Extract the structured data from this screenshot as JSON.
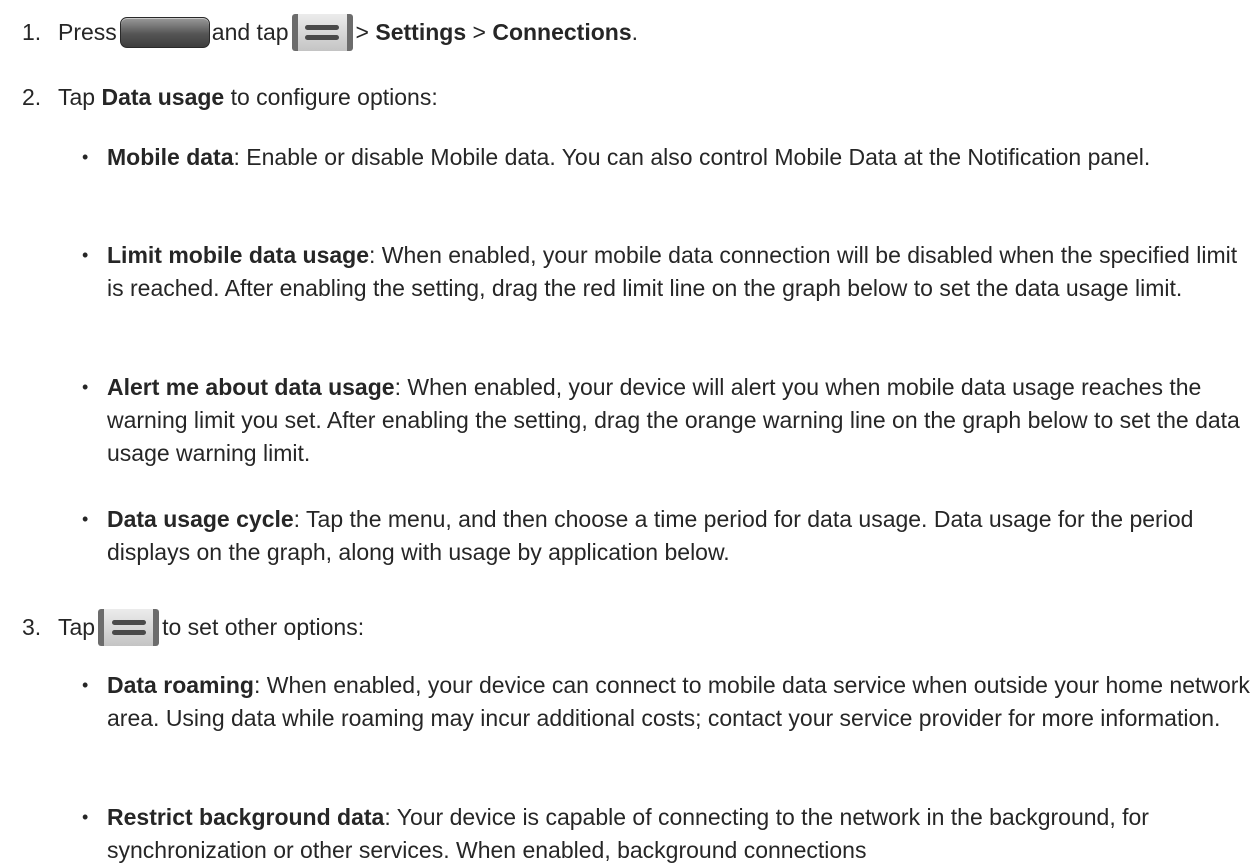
{
  "step1": {
    "number": "1.",
    "press": "Press",
    "and_tap": "and tap",
    "sep1": ">",
    "settings": "Settings",
    "sep2": ">",
    "connections": "Connections",
    "end": ".",
    "home_key_icon": "home-key-icon",
    "menu_key_icon": "menu-key-icon"
  },
  "step2": {
    "number": "2.",
    "tap": "Tap",
    "data_usage": "Data usage",
    "rest": "to configure options:"
  },
  "bullets_a": [
    {
      "term": "Mobile data",
      "desc": ": Enable or disable Mobile data. You can also control Mobile Data at the Notification panel."
    },
    {
      "term": "Limit mobile data usage",
      "desc": ": When enabled, your mobile data connection will be disabled when the specified limit is reached. After enabling the setting, drag the red limit line on the graph below to set the data usage limit."
    },
    {
      "term": "Alert me about data usage",
      "desc": ": When enabled, your device will alert you when mobile data usage reaches the warning limit you set. After enabling the setting, drag the orange warning line on the graph below to set the data usage warning limit."
    },
    {
      "term": "Data usage cycle",
      "desc": ": Tap the menu, and then choose a time period for data usage. Data usage for the period displays on the graph, along with usage by application below."
    }
  ],
  "step3": {
    "number": "3.",
    "tap": "Tap",
    "rest": "to set other options:",
    "menu_key_icon": "menu-key-icon"
  },
  "bullets_b": [
    {
      "term": "Data roaming",
      "desc": ": When enabled, your device can connect to mobile data service when outside your home network area. Using data while roaming may incur additional costs; contact your service provider for more information."
    },
    {
      "term": "Restrict background data",
      "desc": ": Your device is capable of connecting to the network in the background, for synchronization or other services. When enabled, background connections"
    }
  ],
  "bullet_char": "•"
}
